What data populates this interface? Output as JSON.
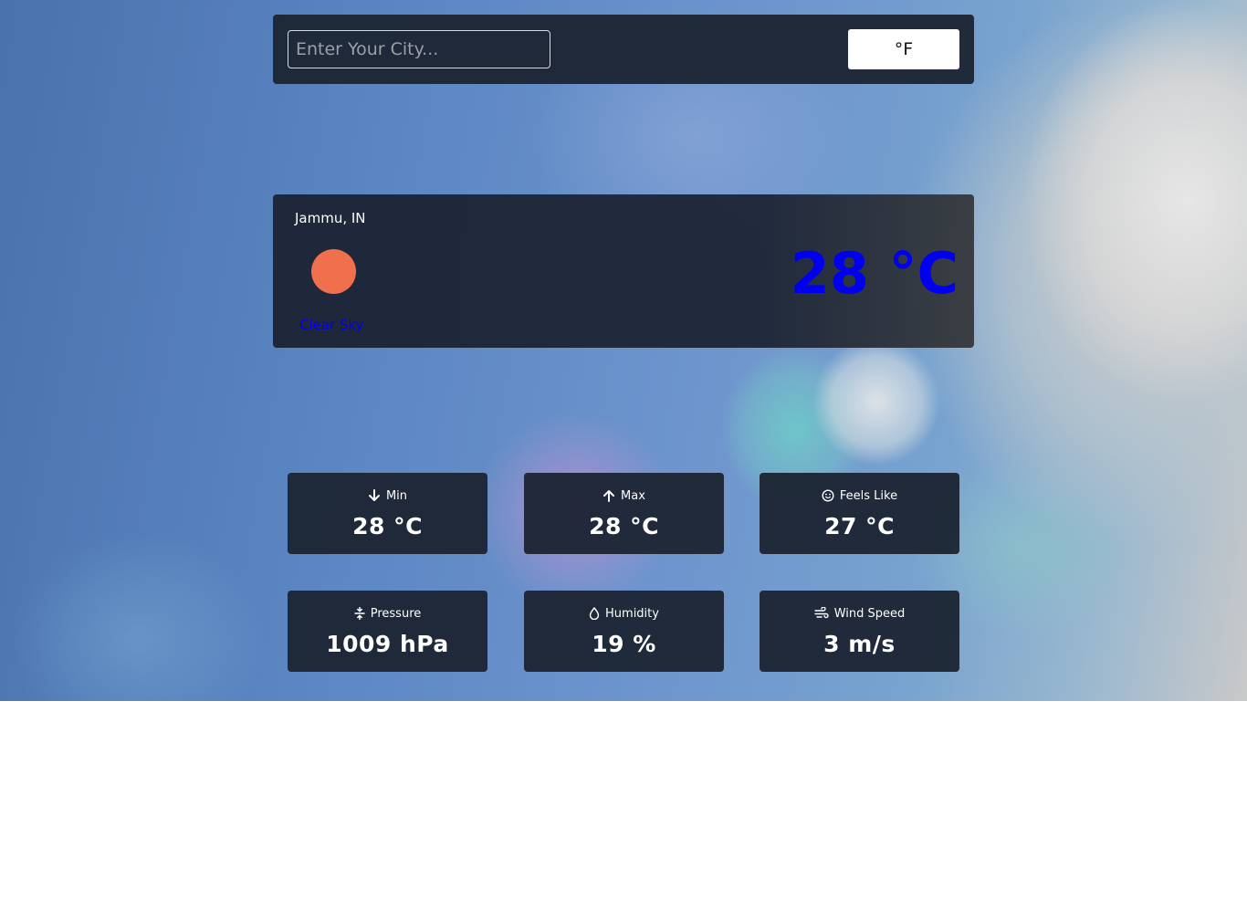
{
  "search": {
    "placeholder": "Enter Your City..."
  },
  "unit_toggle": {
    "label": "°F"
  },
  "current": {
    "location": "Jammu, IN",
    "condition": "Clear Sky",
    "temperature": "28 °C",
    "icon": "sun-icon",
    "icon_color": "#f0704d",
    "accent_color": "#0000ee"
  },
  "stats": [
    {
      "icon": "arrow-down-icon",
      "label": "Min",
      "value": "28 °C"
    },
    {
      "icon": "arrow-up-icon",
      "label": "Max",
      "value": "28 °C"
    },
    {
      "icon": "smile-icon",
      "label": "Feels Like",
      "value": "27 °C"
    },
    {
      "icon": "pressure-icon",
      "label": "Pressure",
      "value": "1009 hPa"
    },
    {
      "icon": "droplet-icon",
      "label": "Humidity",
      "value": "19 %"
    },
    {
      "icon": "wind-icon",
      "label": "Wind Speed",
      "value": "3 m/s"
    }
  ]
}
